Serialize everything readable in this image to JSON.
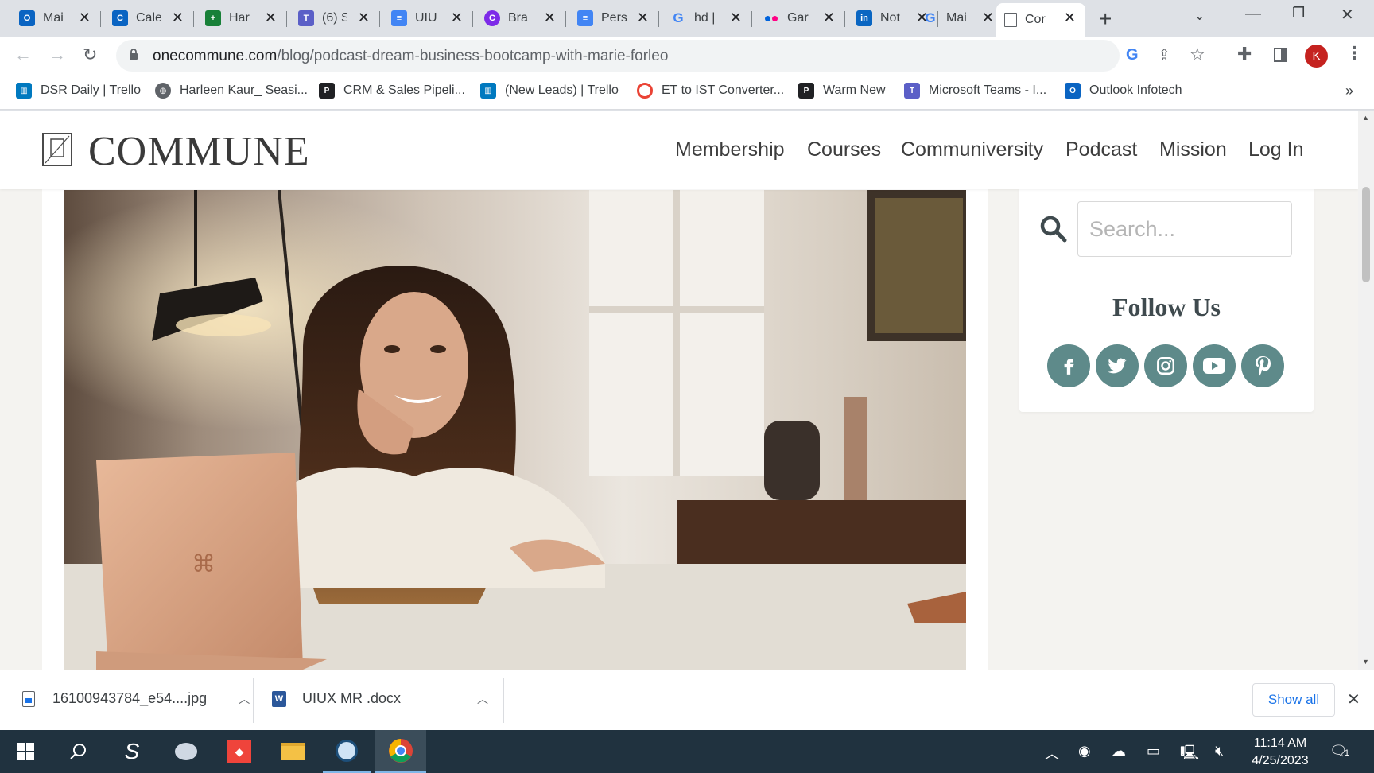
{
  "browser": {
    "tabs": [
      {
        "title": "Mai",
        "favicon": "outlook-icon",
        "color": "#0a64c2"
      },
      {
        "title": "Cale",
        "favicon": "calendar-icon",
        "color": "#0a64c2"
      },
      {
        "title": "Har",
        "favicon": "sheets-icon",
        "color": "#188038"
      },
      {
        "title": "(6) S",
        "favicon": "teams-icon",
        "color": "#5b5fc7"
      },
      {
        "title": "UIU",
        "favicon": "docs-icon",
        "color": "#4285f4"
      },
      {
        "title": "Bra",
        "favicon": "canva-icon",
        "color": "#7d2ae8"
      },
      {
        "title": "Pers",
        "favicon": "docs-icon",
        "color": "#4285f4"
      },
      {
        "title": "hd |",
        "favicon": "google-icon",
        "color": "#ffffff"
      },
      {
        "title": "Gar",
        "favicon": "flickr-icon",
        "color": "#ffffff"
      },
      {
        "title": "Not",
        "favicon": "linkedin-icon",
        "color": "#0a66c2"
      },
      {
        "title": "Mai",
        "favicon": "google-icon",
        "color": "#ffffff"
      },
      {
        "title": "Cor",
        "favicon": "commune-icon",
        "color": "#ffffff",
        "active": true
      }
    ],
    "url_host": "onecommune.com",
    "url_path": "/blog/podcast-dream-business-bootcamp-with-marie-forleo",
    "profile_initial": "K",
    "bookmarks": [
      {
        "label": "DSR Daily | Trello",
        "icon": "trello-icon"
      },
      {
        "label": "Harleen Kaur_ Seasi...",
        "icon": "globe-icon"
      },
      {
        "label": "CRM & Sales Pipeli...",
        "icon": "crm-icon"
      },
      {
        "label": "(New Leads) | Trello",
        "icon": "trello-icon"
      },
      {
        "label": "ET to IST Converter...",
        "icon": "clock-icon"
      },
      {
        "label": "Warm New",
        "icon": "crm-icon"
      },
      {
        "label": "Microsoft Teams - I...",
        "icon": "teams-icon"
      },
      {
        "label": "Outlook Infotech",
        "icon": "outlook-icon"
      }
    ],
    "more_bookmarks": "»"
  },
  "site": {
    "logo": "COMMUNE",
    "nav": [
      "Membership",
      "Courses",
      "Communiversity",
      "Podcast",
      "Mission",
      "Log In"
    ],
    "search_placeholder": "Search...",
    "follow_title": "Follow Us",
    "social": [
      "facebook-icon",
      "twitter-icon",
      "instagram-icon",
      "youtube-icon",
      "pinterest-icon"
    ],
    "social_color": "#5e8a8a"
  },
  "downloads": {
    "items": [
      "16100943784_e54....jpg",
      "UIUX MR .docx"
    ],
    "show_all": "Show all"
  },
  "taskbar": {
    "time": "11:14 AM",
    "date": "4/25/2023",
    "notifications": "1"
  }
}
